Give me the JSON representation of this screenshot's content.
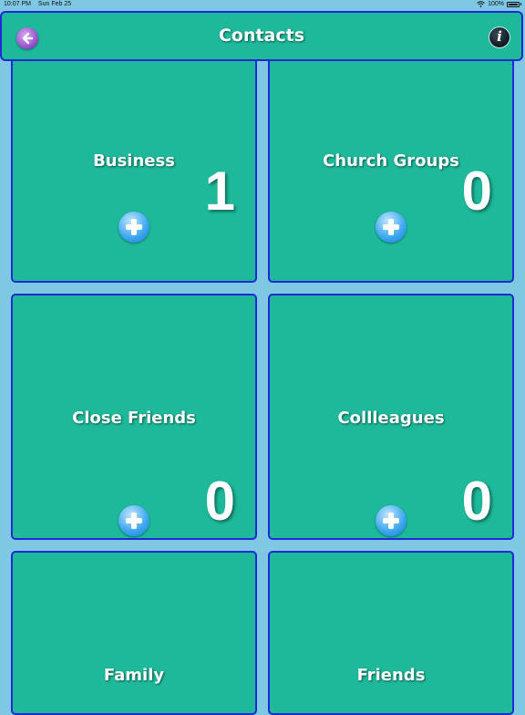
{
  "status_bar": {
    "time": "10:07 PM",
    "date": "Sun Feb 25",
    "battery": "100%",
    "wifi_icon": "wifi-icon",
    "battery_icon": "battery-icon"
  },
  "header": {
    "title": "Contacts",
    "back_icon": "back-arrow-icon",
    "info_icon": "info-icon"
  },
  "groups": [
    {
      "name": "Business",
      "count": "1"
    },
    {
      "name": "Church Groups",
      "count": "0"
    },
    {
      "name": "Close Friends",
      "count": "0"
    },
    {
      "name": "Collleagues",
      "count": "0"
    },
    {
      "name": "Family",
      "count": ""
    },
    {
      "name": "Friends",
      "count": ""
    }
  ],
  "colors": {
    "background": "#7ec8e3",
    "tile": "#1db99a",
    "border": "#1e2ad6"
  }
}
